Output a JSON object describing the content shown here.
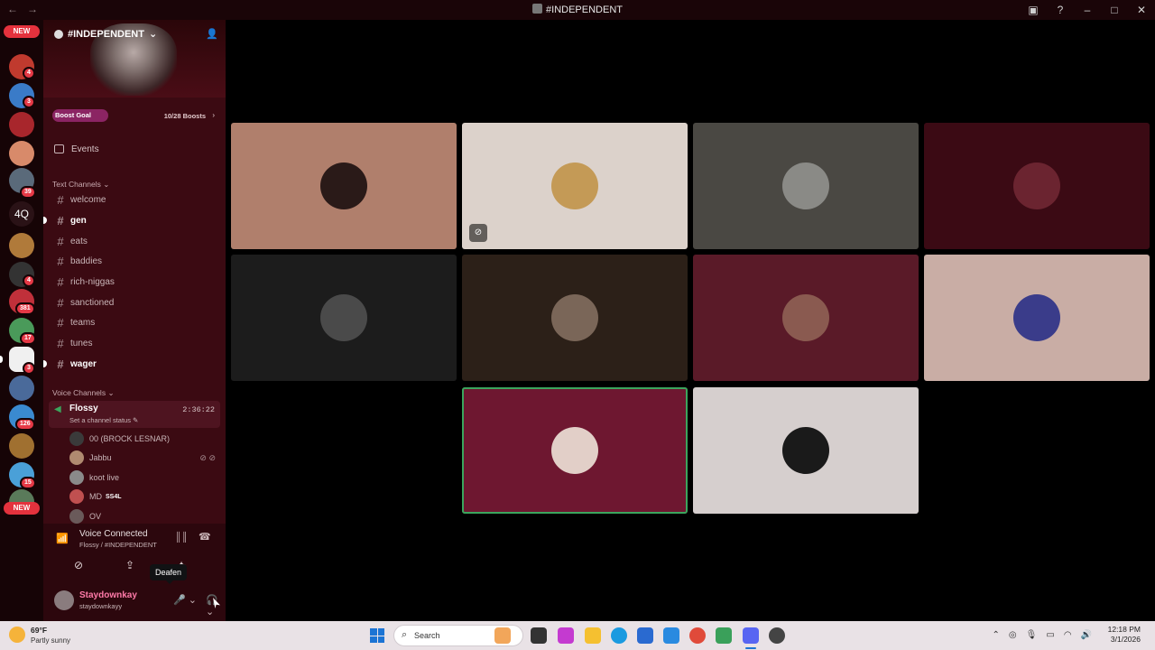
{
  "window": {
    "title": "#INDEPENDENT",
    "back_icon": "arrow-left-icon",
    "forward_icon": "arrow-right-icon",
    "controls": [
      "inbox-icon",
      "help-icon",
      "minimize-icon",
      "maximize-icon",
      "close-icon"
    ]
  },
  "rail": {
    "new_top": "NEW",
    "new_bottom": "NEW",
    "text_server": "4Q",
    "badges": [
      "4",
      "3",
      "39",
      "4",
      "381",
      "17",
      "3",
      "126",
      "15",
      "4"
    ]
  },
  "server": {
    "name": "#INDEPENDENT",
    "boost_label": "Boost Goal",
    "boost_count": "10/28 Boosts",
    "events_label": "Events"
  },
  "text_channels": {
    "header": "Text Channels",
    "items": [
      {
        "name": "welcome",
        "unread": false
      },
      {
        "name": "gen",
        "unread": true
      },
      {
        "name": "eats",
        "unread": false
      },
      {
        "name": "baddies",
        "unread": false
      },
      {
        "name": "rich-niggas",
        "unread": false
      },
      {
        "name": "sanctioned",
        "unread": false
      },
      {
        "name": "teams",
        "unread": false
      },
      {
        "name": "tunes",
        "unread": false
      },
      {
        "name": "wager",
        "unread": true
      }
    ]
  },
  "voice_channels": {
    "header": "Voice Channels",
    "active": {
      "name": "Flossy",
      "timer": "2:36:22",
      "status": "Set a channel status"
    },
    "users": [
      {
        "name": "00 (BROCK LESNAR)",
        "tag": ""
      },
      {
        "name": "Jabbu",
        "tag": ""
      },
      {
        "name": "koot live",
        "tag": ""
      },
      {
        "name": "MD",
        "tag": "SS4L"
      },
      {
        "name": "OV",
        "tag": ""
      }
    ]
  },
  "voice_panel": {
    "title": "Voice Connected",
    "subtitle": "Flossy / #INDEPENDENT",
    "tooltip": "Deafen"
  },
  "user": {
    "display_name": "Staydownkay",
    "handle": "staydownkayy"
  },
  "tiles": [
    {
      "bg": "#b07f6c",
      "avatar": "#2a1a18"
    },
    {
      "bg": "#dcd2cb",
      "avatar": "#c49a56",
      "camoff": true
    },
    {
      "bg": "#4a4843",
      "avatar": "#8a8a86"
    },
    {
      "bg": "#3b0a14",
      "avatar": "#6b2430"
    },
    {
      "bg": "#1c1c1c",
      "avatar": "#4a4a4a"
    },
    {
      "bg": "#2c2018",
      "avatar": "#7a6658"
    },
    {
      "bg": "#5a1a28",
      "avatar": "#8a5a50"
    },
    {
      "bg": "#c9ada5",
      "avatar": "#3a3c8a"
    },
    {
      "bg": "#6e1730",
      "avatar": "#e2cfc8",
      "speaking": true
    },
    {
      "bg": "#d6cfce",
      "avatar": "#1a1a1a"
    }
  ],
  "taskbar": {
    "weather_temp": "69°F",
    "weather_desc": "Partly sunny",
    "weather_badge": "2",
    "search_label": "Search",
    "time": "12:18 PM",
    "date": "3/1/2026"
  }
}
